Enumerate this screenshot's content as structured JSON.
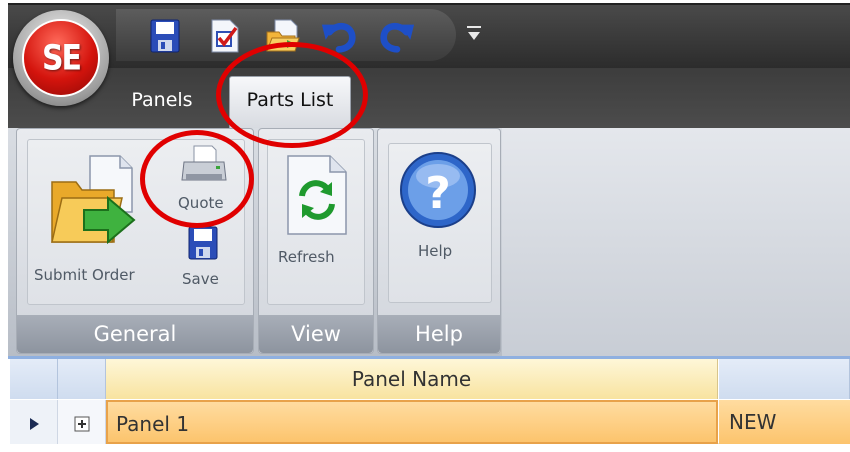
{
  "orb": {
    "label": "SE"
  },
  "quick_access": {
    "items": [
      "save-icon",
      "checklist-icon",
      "open-folder-icon",
      "undo-icon",
      "redo-icon",
      "customize-dropdown-icon"
    ]
  },
  "tabs": [
    {
      "label": "Panels",
      "active": false
    },
    {
      "label": "Parts List",
      "active": true
    }
  ],
  "ribbon": {
    "groups": [
      {
        "caption": "General",
        "buttons": [
          {
            "label": "Submit Order",
            "icon": "submit-order-icon"
          },
          {
            "label": "Quote",
            "icon": "printer-icon"
          },
          {
            "label": "Save",
            "icon": "save-icon"
          }
        ]
      },
      {
        "caption": "View",
        "buttons": [
          {
            "label": "Refresh",
            "icon": "refresh-icon"
          }
        ]
      },
      {
        "caption": "Help",
        "buttons": [
          {
            "label": "Help",
            "icon": "help-icon"
          }
        ]
      }
    ]
  },
  "grid": {
    "columns": [
      "Panel Name"
    ],
    "rows": [
      {
        "panel_name": "Panel 1",
        "status": "NEW",
        "selected": true
      }
    ]
  },
  "colors": {
    "annotation": "#e00000",
    "header_yellow": "#f8e3a0",
    "selected_row": "#fcc46d"
  }
}
